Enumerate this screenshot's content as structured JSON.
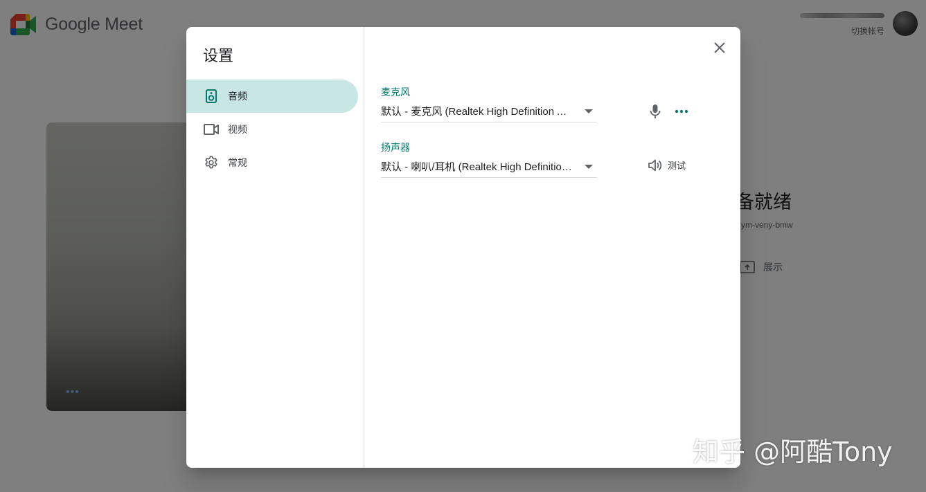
{
  "background": {
    "app_name": "Google Meet",
    "account": {
      "switch_account_label": "切换帐号"
    },
    "ready_title_fragment": "备就绪",
    "meeting_code_fragment": "ym-veny-bmw",
    "present_label": "展示",
    "video_more_label": "•••"
  },
  "dialog": {
    "title": "设置",
    "nav": {
      "audio": "音频",
      "video": "视频",
      "general": "常规"
    },
    "microphone": {
      "label": "麦克风",
      "value": "默认 - 麦克风 (Realtek High Definition Audio)"
    },
    "speaker": {
      "label": "扬声器",
      "value": "默认 - 喇叭/耳机 (Realtek High Definition Audio)",
      "test_label": "测试"
    }
  },
  "watermark": "知乎 @阿酷Tony",
  "colors": {
    "accent": "#00796b",
    "nav_active_bg": "#c8e6e3",
    "scrim": "rgba(0,0,0,0.5)"
  },
  "icons": {
    "audio": "speaker-icon",
    "video": "videocam-icon",
    "general": "gear-icon",
    "close": "close-icon",
    "mic": "microphone-icon",
    "more": "more-horiz-icon",
    "volume": "volume-icon",
    "caret": "dropdown-caret-icon"
  }
}
